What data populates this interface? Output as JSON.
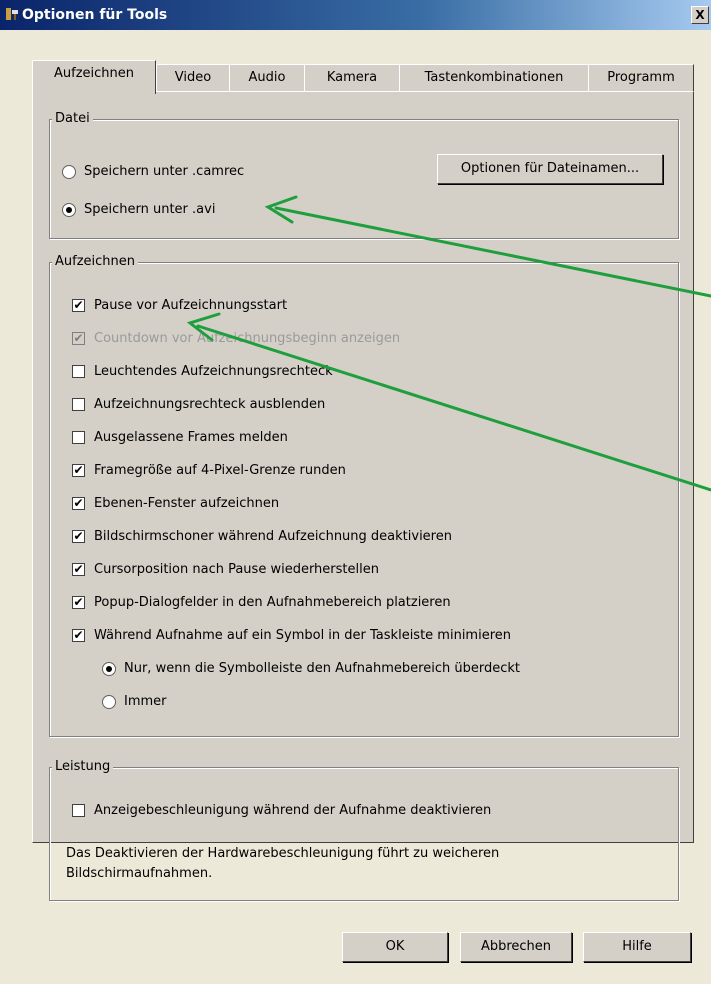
{
  "window": {
    "title": "Optionen für Tools",
    "close_glyph": "X",
    "icon": "tools-icon"
  },
  "tabs": [
    {
      "label": "Aufzeichnen",
      "active": true
    },
    {
      "label": "Video",
      "active": false
    },
    {
      "label": "Audio",
      "active": false
    },
    {
      "label": "Kamera",
      "active": false
    },
    {
      "label": "Tastenkombinationen",
      "active": false
    },
    {
      "label": "Programm",
      "active": false
    }
  ],
  "datei": {
    "legend": "Datei",
    "options": [
      {
        "label": "Speichern unter .camrec",
        "selected": false
      },
      {
        "label": "Speichern unter .avi",
        "selected": true
      }
    ],
    "filename_button": "Optionen für Dateinamen..."
  },
  "aufzeichnen": {
    "legend": "Aufzeichnen",
    "options": [
      {
        "label": "Pause vor Aufzeichnungsstart",
        "checked": true,
        "enabled": true
      },
      {
        "label": "Countdown vor Aufzeichnungsbeginn anzeigen",
        "checked": true,
        "enabled": false
      },
      {
        "label": "Leuchtendes Aufzeichnungsrechteck",
        "checked": false,
        "enabled": true
      },
      {
        "label": "Aufzeichnungsrechteck ausblenden",
        "checked": false,
        "enabled": true
      },
      {
        "label": "Ausgelassene Frames melden",
        "checked": false,
        "enabled": true
      },
      {
        "label": "Framegröße auf 4-Pixel-Grenze runden",
        "checked": true,
        "enabled": true
      },
      {
        "label": "Ebenen-Fenster aufzeichnen",
        "checked": true,
        "enabled": true
      },
      {
        "label": "Bildschirmschoner während Aufzeichnung deaktivieren",
        "checked": true,
        "enabled": true
      },
      {
        "label": "Cursorposition nach Pause wiederherstellen",
        "checked": true,
        "enabled": true
      },
      {
        "label": "Popup-Dialogfelder in den Aufnahmebereich platzieren",
        "checked": true,
        "enabled": true
      },
      {
        "label": "Während Aufnahme auf ein Symbol in der Taskleiste minimieren",
        "checked": true,
        "enabled": true
      }
    ],
    "minimize_options": [
      {
        "label": "Nur, wenn die Symbolleiste den Aufnahmebereich überdeckt",
        "selected": true
      },
      {
        "label": "Immer",
        "selected": false
      }
    ]
  },
  "leistung": {
    "legend": "Leistung",
    "option": {
      "label": "Anzeigebeschleunigung während der Aufnahme deaktivieren",
      "checked": false
    },
    "info": "Das Deaktivieren der Hardwarebeschleunigung führt zu weicheren Bildschirmaufnahmen."
  },
  "buttons": {
    "ok": "OK",
    "cancel": "Abbrechen",
    "help": "Hilfe"
  },
  "annotation_color": "#1e9e3c",
  "check_glyph": "✔"
}
